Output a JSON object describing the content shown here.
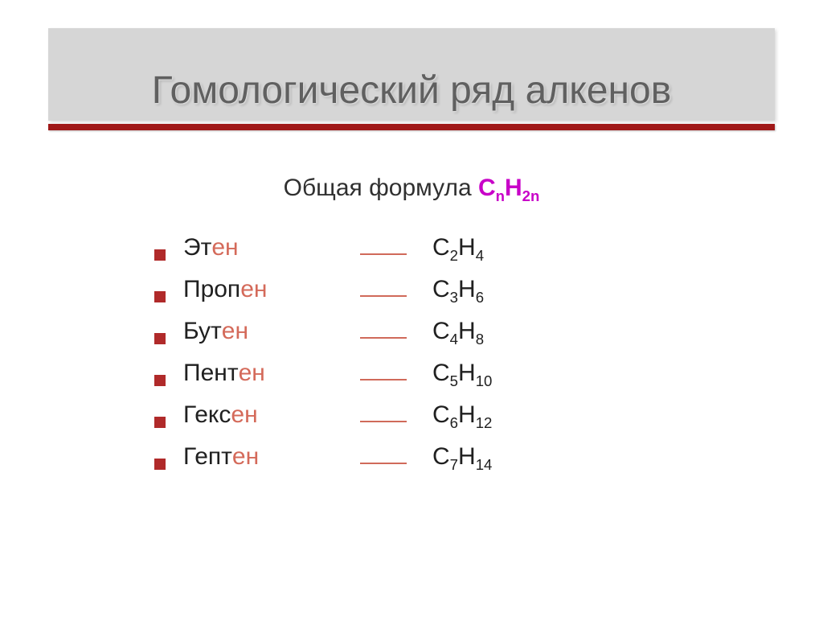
{
  "title": "Гомологический ряд алкенов",
  "subtitle_prefix": "Общая формула ",
  "general_formula": {
    "C": "C",
    "n": "n",
    "H": "H",
    "two_n": "2n"
  },
  "rows": [
    {
      "name_black": "Эт",
      "name_red": "ен",
      "c_label": "C",
      "c_sub": "2",
      "h_label": "H",
      "h_sub": "4"
    },
    {
      "name_black": "Проп",
      "name_red": "ен",
      "c_label": "C",
      "c_sub": "3",
      "h_label": "H",
      "h_sub": "6"
    },
    {
      "name_black": "Бут",
      "name_red": "ен",
      "c_label": "C",
      "c_sub": "4",
      "h_label": "H",
      "h_sub": "8"
    },
    {
      "name_black": "Пент",
      "name_red": "ен",
      "c_label": "C",
      "c_sub": "5",
      "h_label": "H",
      "h_sub": "10"
    },
    {
      "name_black": "Гекс",
      "name_red": "ен",
      "c_label": "C",
      "c_sub": "6",
      "h_label": "H",
      "h_sub": "12"
    },
    {
      "name_black": "Гепт",
      "name_red": "ен",
      "c_label": "C",
      "c_sub": "7",
      "h_label": "H",
      "h_sub": "14"
    }
  ]
}
